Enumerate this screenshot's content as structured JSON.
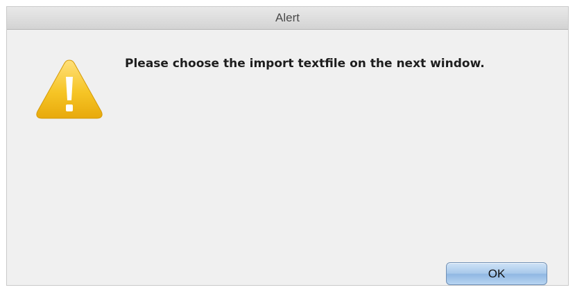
{
  "window": {
    "title": "Alert"
  },
  "alert": {
    "icon": "warning-icon",
    "message": "Please choose the import textfile on the next window."
  },
  "buttons": {
    "ok_label": "OK"
  },
  "colors": {
    "warning_yellow": "#f4c21c",
    "button_blue": "#a7c8ea"
  }
}
